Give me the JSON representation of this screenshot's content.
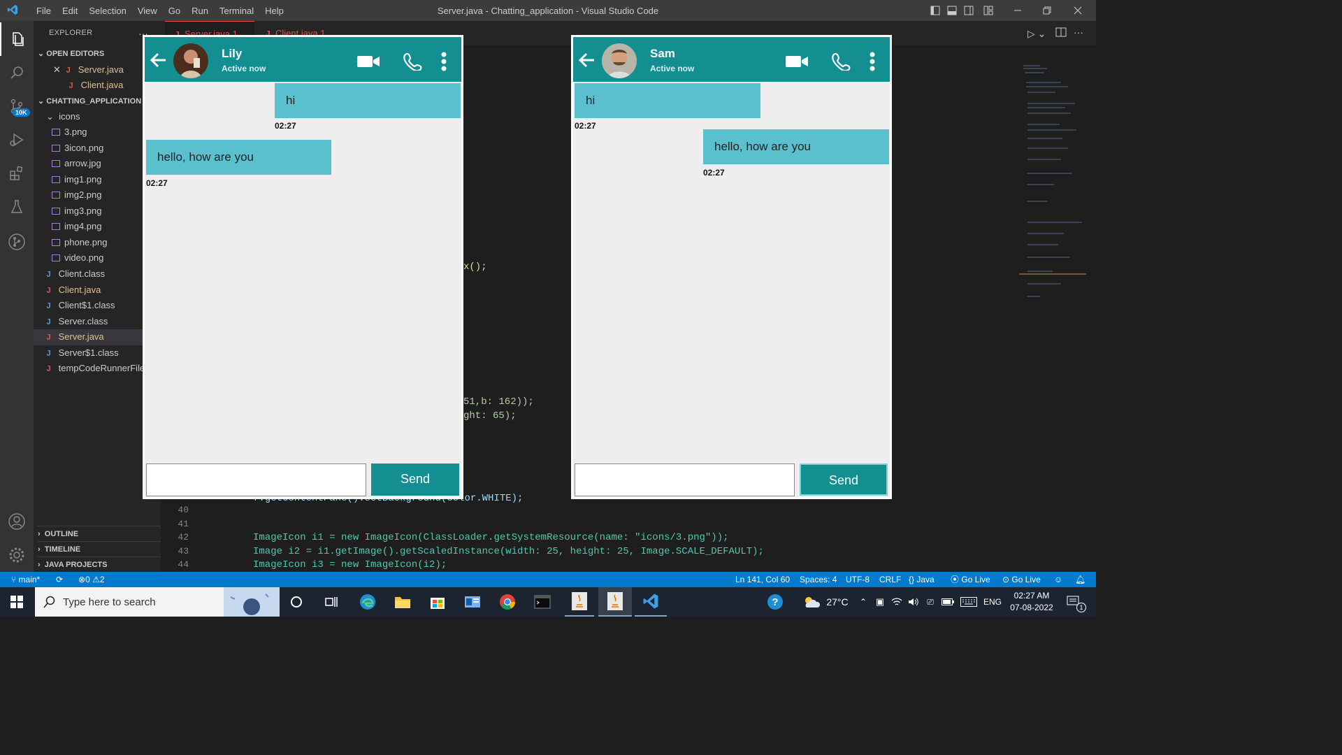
{
  "window": {
    "title": "Server.java - Chatting_application - Visual Studio Code"
  },
  "menu": [
    "File",
    "Edit",
    "Selection",
    "View",
    "Go",
    "Run",
    "Terminal",
    "Help"
  ],
  "explorer": {
    "title": "EXPLORER",
    "open_editors_label": "OPEN EDITORS",
    "open_editors": [
      "Server.java",
      "Client.java"
    ],
    "project_label": "CHATTING_APPLICATION",
    "folder": "icons",
    "icon_files": [
      "3.png",
      "3icon.png",
      "arrow.jpg",
      "img1.png",
      "img2.png",
      "img3.png",
      "img4.png",
      "phone.png",
      "video.png"
    ],
    "files": [
      "Client.class",
      "Client.java",
      "Client$1.class",
      "Server.class",
      "Server.java",
      "Server$1.class",
      "tempCodeRunnerFile"
    ],
    "outline": "OUTLINE",
    "timeline": "TIMELINE",
    "java_projects": "JAVA PROJECTS",
    "scm_badge": "10K"
  },
  "tabs": [
    {
      "label": "Server.java 1"
    },
    {
      "label": "Client.java 1"
    }
  ],
  "code": {
    "visible_fragments": [
      "x();",
      "51,b: 162));",
      "ght: 65);"
    ],
    "l39": "f.getContentPane().setBackground(Color.WHITE);",
    "lines": [
      {
        "num": "39",
        "text": ""
      },
      {
        "num": "40",
        "text": ""
      },
      {
        "num": "41",
        "text": ""
      },
      {
        "num": "42",
        "text": "ImageIcon i1 = new ImageIcon(ClassLoader.getSystemResource(name: \"icons/3.png\"));"
      },
      {
        "num": "43",
        "text": "Image i2 = i1.getImage().getScaledInstance(width: 25, height: 25, Image.SCALE_DEFAULT);"
      },
      {
        "num": "44",
        "text": "ImageIcon i3 = new ImageIcon(i2);"
      }
    ]
  },
  "chat_left": {
    "name": "Lily",
    "status": "Active now",
    "messages": [
      {
        "text": "hi",
        "time": "02:27",
        "side": "right"
      },
      {
        "text": "hello, how are you",
        "time": "02:27",
        "side": "left"
      }
    ],
    "send_label": "Send",
    "input_value": ""
  },
  "chat_right": {
    "name": "Sam",
    "status": "Active now",
    "messages": [
      {
        "text": "hi",
        "time": "02:27",
        "side": "left"
      },
      {
        "text": "hello, how are you",
        "time": "02:27",
        "side": "right"
      }
    ],
    "send_label": "Send",
    "input_value": ""
  },
  "statusbar": {
    "branch": "main*",
    "errors": "0",
    "warnings": "2",
    "position": "Ln 141, Col 60",
    "spaces": "Spaces: 4",
    "encoding": "UTF-8",
    "eol": "CRLF",
    "language": "Java",
    "golive1": "Go Live",
    "golive2": "Go Live"
  },
  "taskbar": {
    "search_placeholder": "Type here to search",
    "weather": "27°C",
    "lang": "ENG",
    "time": "02:27 AM",
    "date": "07-08-2022",
    "notif_count": "1"
  },
  "colors": {
    "accent": "#138f92",
    "bubble": "#5bc0cd",
    "statusbar": "#007acc"
  }
}
